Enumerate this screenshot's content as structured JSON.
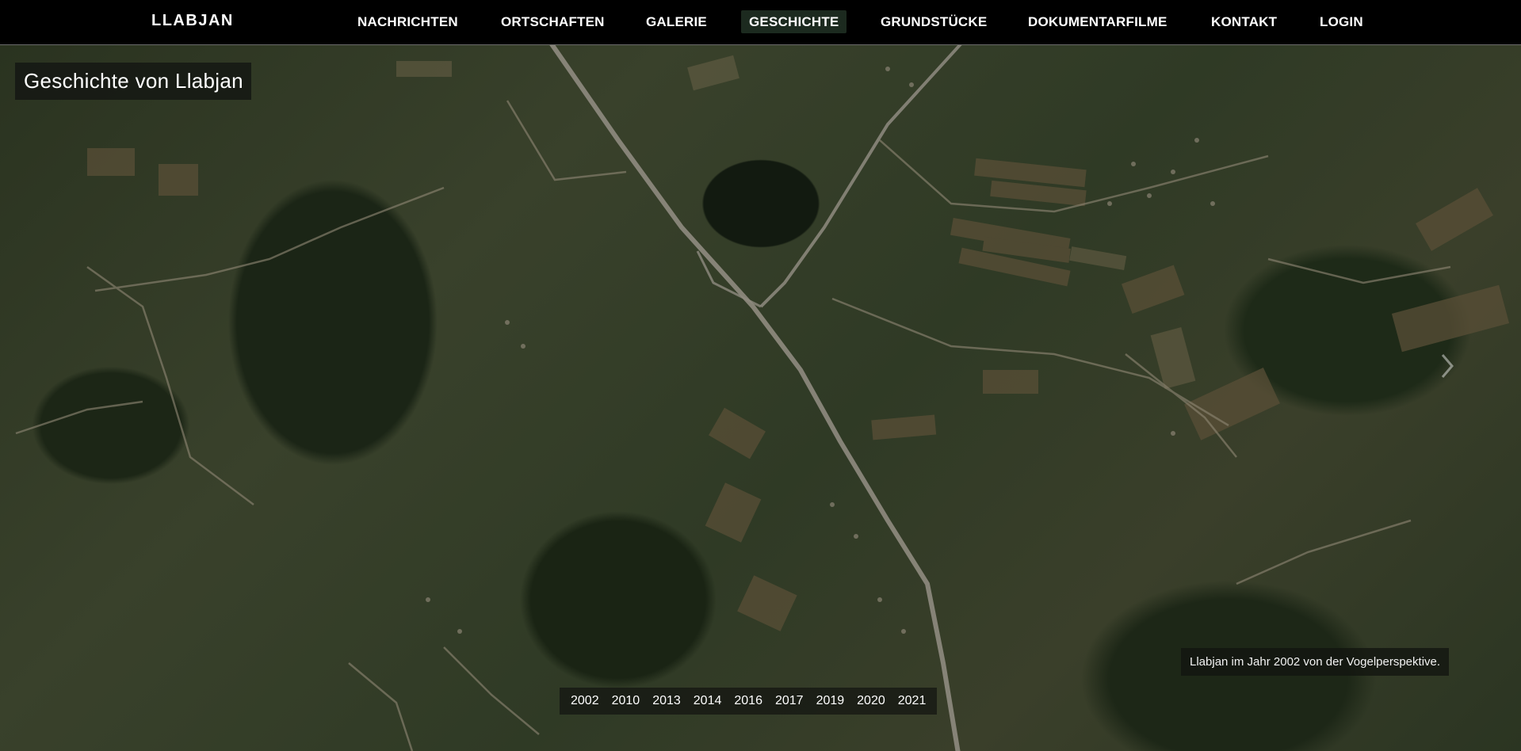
{
  "brand": "LLABJAN",
  "nav": {
    "items": [
      {
        "label": "NACHRICHTEN"
      },
      {
        "label": "ORTSCHAFTEN"
      },
      {
        "label": "GALERIE"
      },
      {
        "label": "GESCHICHTE",
        "active": true
      },
      {
        "label": "GRUNDSTÜCKE"
      },
      {
        "label": "DOKUMENTARFILME"
      },
      {
        "label": "KONTAKT"
      },
      {
        "label": "LOGIN"
      }
    ]
  },
  "hero": {
    "title": "Geschichte von Llabjan",
    "caption": "Llabjan im Jahr 2002 von der Vogelperspektive.",
    "next_icon": "chevron-right-icon",
    "years": [
      "2002",
      "2010",
      "2013",
      "2014",
      "2016",
      "2017",
      "2019",
      "2020",
      "2021"
    ]
  },
  "colors": {
    "topbar": "#000000",
    "active_tab": "#1c2a1f",
    "forest": "#1b2516",
    "field": "#4a4a33",
    "road": "#9a968a"
  }
}
